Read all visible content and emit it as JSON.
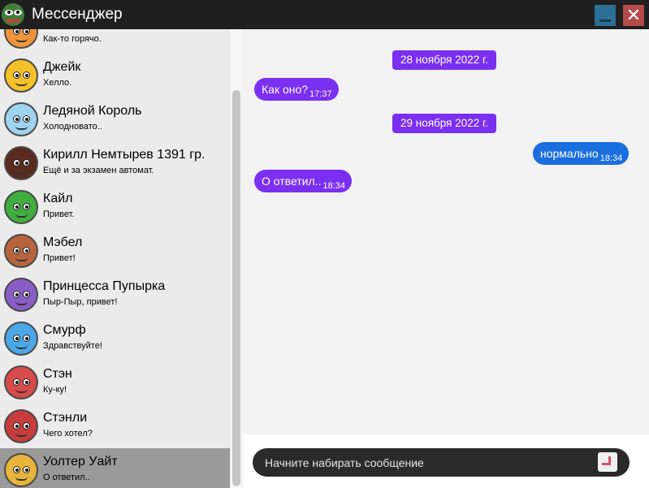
{
  "window": {
    "title": "Мессенджер",
    "app_icon": "frog-icon",
    "minimize_icon": "minimize-icon",
    "close_icon": "close-icon",
    "close_glyph": "✕",
    "minimize_color": "#2b6f96",
    "close_color": "#b54a4a"
  },
  "sidebar": {
    "chats": [
      {
        "name": "",
        "preview": "Как-то горячо.",
        "avatar": "fire-character-icon",
        "avatar_color": "#f2953a"
      },
      {
        "name": "Джейк",
        "preview": "Хелло.",
        "avatar": "jake-icon",
        "avatar_color": "#f5c12a"
      },
      {
        "name": "Ледяной Король",
        "preview": "Холодновато..",
        "avatar": "ice-king-icon",
        "avatar_color": "#9fd4f0"
      },
      {
        "name": "Кирилл Немтырев 1391 гр.",
        "preview": "Ещё и за экзамен автомат.",
        "avatar": "user-photo-icon",
        "avatar_color": "#5a2a1e"
      },
      {
        "name": "Кайл",
        "preview": "Привет.",
        "avatar": "kyle-icon",
        "avatar_color": "#3fae3f"
      },
      {
        "name": "Мэбел",
        "preview": "Привет!",
        "avatar": "mabel-icon",
        "avatar_color": "#b8643c"
      },
      {
        "name": "Принцесса Пупырка",
        "preview": "Пыр-Пыр, привет!",
        "avatar": "lumpy-space-princess-icon",
        "avatar_color": "#8a5cc8"
      },
      {
        "name": "Смурф",
        "preview": "Здравствуйте!",
        "avatar": "smurf-icon",
        "avatar_color": "#4aa8e8"
      },
      {
        "name": "Стэн",
        "preview": "Ку-ку!",
        "avatar": "stan-icon",
        "avatar_color": "#d94a4a"
      },
      {
        "name": "Стэнли",
        "preview": "Чего хотел?",
        "avatar": "stanley-icon",
        "avatar_color": "#c83c3c"
      },
      {
        "name": "Уолтер Уайт",
        "preview": "О ответил..",
        "avatar": "heisenberg-icon",
        "avatar_color": "#e8b43a",
        "active": true
      }
    ]
  },
  "conversation": {
    "dates": [
      "28 ноября 2022 г.",
      "29 ноября 2022 г."
    ],
    "messages": [
      {
        "text": "Как оно?",
        "time": "17:37",
        "direction": "incoming"
      },
      {
        "text": "нормально",
        "time": "18:34",
        "direction": "outgoing"
      },
      {
        "text": "О ответил..",
        "time": "18:34",
        "direction": "incoming"
      }
    ]
  },
  "composer": {
    "placeholder": "Начните набирать сообщение",
    "value": "",
    "send_icon": "send-enter-icon"
  },
  "colors": {
    "incoming_bubble": "#7b2ff0",
    "outgoing_bubble": "#1a6ee0",
    "active_chat": "#9a9a9a"
  }
}
